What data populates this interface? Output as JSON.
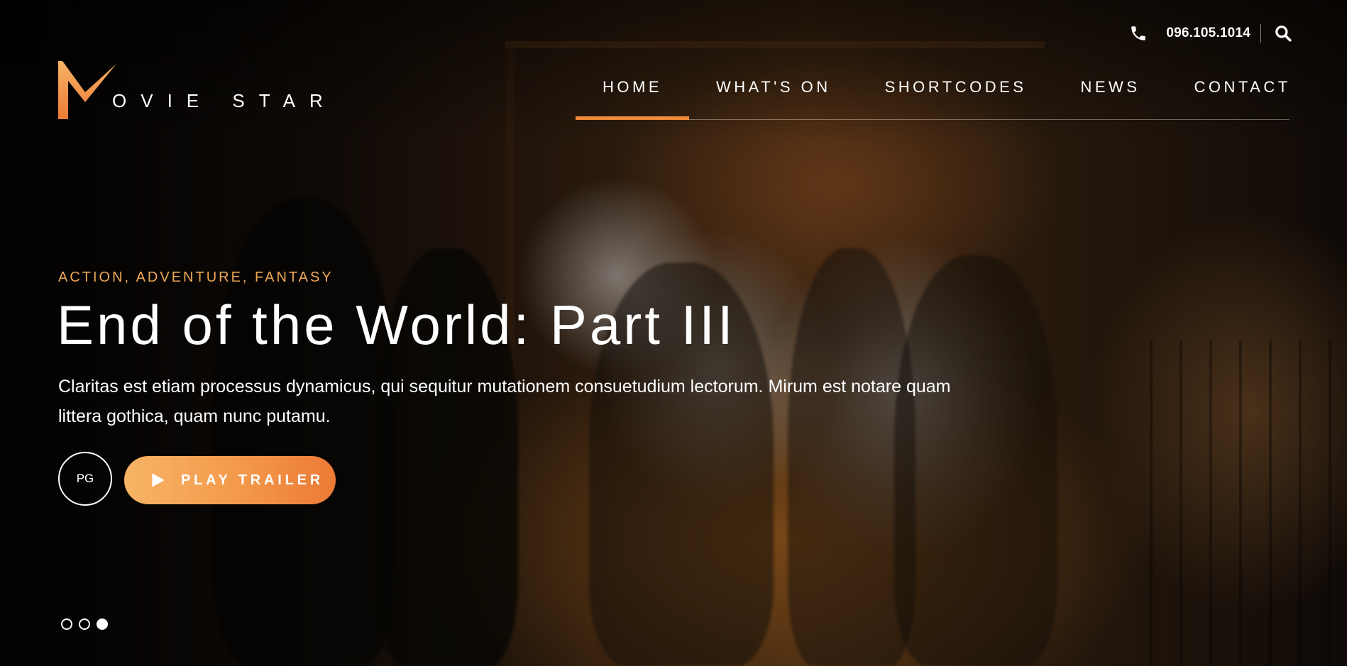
{
  "brand": {
    "logo_text": "OVIE STAR",
    "logo_mark": "M",
    "accent_color": "#ef8a3a",
    "accent_gradient": [
      "#f7b466",
      "#ec7a35"
    ]
  },
  "topbar": {
    "phone_icon": "phone-icon",
    "phone": "096.105.1014",
    "search_icon": "search-icon"
  },
  "nav": {
    "items": [
      {
        "label": "HOME",
        "active": true
      },
      {
        "label": "WHAT'S ON",
        "active": false
      },
      {
        "label": "SHORTCODES",
        "active": false
      },
      {
        "label": "NEWS",
        "active": false
      },
      {
        "label": "CONTACT",
        "active": false
      }
    ]
  },
  "hero": {
    "genres": "ACTION, ADVENTURE, FANTASY",
    "title": "End of the World: Part III",
    "description": "Claritas est etiam processus dynamicus, qui sequitur mutationem consuetudium lectorum. Mirum est notare quam littera gothica, quam nunc putamu.",
    "rating": "PG",
    "play_button": {
      "label": "PLAY TRAILER",
      "icon": "play-icon"
    }
  },
  "slider": {
    "total": 3,
    "active_index": 2
  }
}
